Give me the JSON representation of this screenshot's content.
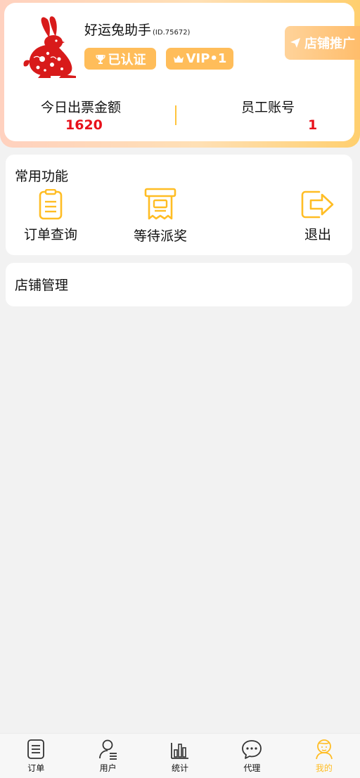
{
  "profile": {
    "shop_name": "好运兔助手",
    "shop_id": "(ID.75672)",
    "verified_label": "已认证",
    "vip_label": "VIP•1",
    "promo_label": "店铺推广"
  },
  "stats": [
    {
      "label": "今日出票金额",
      "value": "1620"
    },
    {
      "label": "员工账号",
      "value": "1"
    }
  ],
  "common_functions": {
    "title": "常用功能",
    "items": [
      {
        "label": "订单查询",
        "icon": "clipboard-icon"
      },
      {
        "label": "等待派奖",
        "icon": "receipt-icon"
      },
      {
        "label": "退出",
        "icon": "logout-icon"
      }
    ]
  },
  "store_management": {
    "title": "店铺管理"
  },
  "tabbar": {
    "items": [
      {
        "label": "订单",
        "icon": "order-icon"
      },
      {
        "label": "用户",
        "icon": "user-icon"
      },
      {
        "label": "统计",
        "icon": "chart-icon"
      },
      {
        "label": "代理",
        "icon": "chat-icon"
      },
      {
        "label": "我的",
        "icon": "profile-icon"
      }
    ],
    "active": "我的"
  },
  "colors": {
    "accent": "#ffbd24",
    "badge": "#ffbd5a",
    "value_red": "#e8111b",
    "background": "#f2f2f2"
  }
}
